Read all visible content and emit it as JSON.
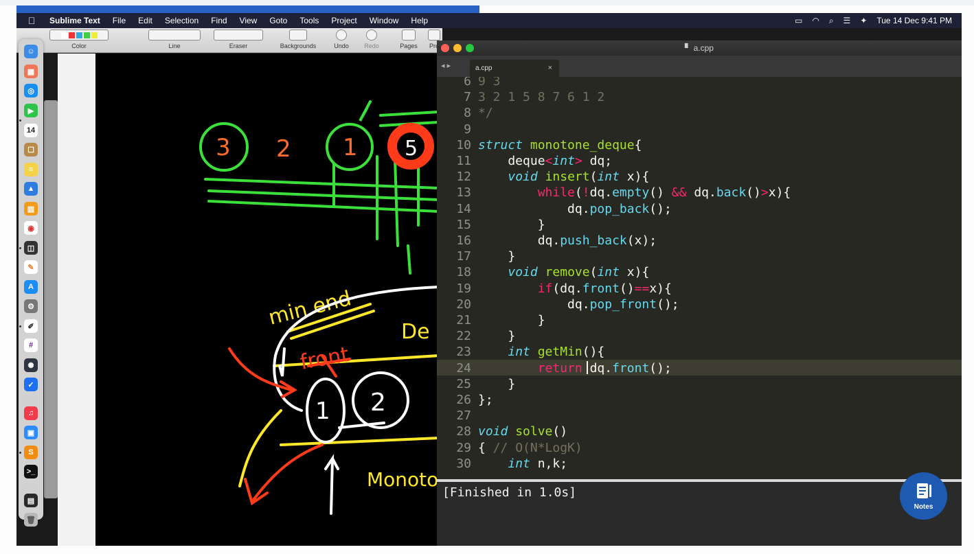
{
  "menubar": {
    "app_name": "Sublime Text",
    "items": [
      "File",
      "Edit",
      "Selection",
      "Find",
      "View",
      "Goto",
      "Tools",
      "Project",
      "Window",
      "Help"
    ],
    "clock": "Tue 14 Dec  9:41 PM"
  },
  "whiteboard_toolbar": {
    "groups": [
      "Color",
      "Line",
      "Eraser",
      "Backgrounds",
      "Undo",
      "Redo",
      "Pages",
      "Pre"
    ]
  },
  "dock": {
    "calendar_day": "14"
  },
  "whiteboard": {
    "labels": [
      "3",
      "2",
      "1",
      "5",
      "min end",
      "front",
      "De",
      "1",
      "2",
      "Monoto"
    ]
  },
  "sublime": {
    "window_title": "a.cpp",
    "tab_label": "a.cpp",
    "tab_close": "×",
    "nav_arrows": "◂ ▸",
    "line_numbers": [
      "6",
      "7",
      "8",
      "9",
      "10",
      "11",
      "12",
      "13",
      "14",
      "15",
      "16",
      "17",
      "18",
      "19",
      "20",
      "21",
      "22",
      "23",
      "24",
      "25",
      "26",
      "27",
      "28",
      "29",
      "30"
    ],
    "code_lines": [
      "9 3",
      "3 2 1 5 8 7 6 1 2",
      "*/",
      "",
      "struct monotone_deque{",
      "    deque<int> dq;",
      "    void insert(int x){",
      "        while(!dq.empty() && dq.back()>x){",
      "            dq.pop_back();",
      "        }",
      "        dq.push_back(x);",
      "    }",
      "    void remove(int x){",
      "        if(dq.front()==x){",
      "            dq.pop_front();",
      "        }",
      "    }",
      "    int getMin(){",
      "        return dq.front();",
      "    }",
      "};",
      "",
      "void solve()",
      "{ // O(N*LogK)",
      "    int n,k;"
    ],
    "console_output": "[Finished in 1.0s]"
  },
  "notes_button": {
    "label": "Notes"
  },
  "colors": {
    "editor_bg": "#272822",
    "keyword": "#66d9ef",
    "control": "#f92672",
    "function": "#a6e22e",
    "comment": "#75715e",
    "menubar_bg": "#1f2236",
    "notes_bg": "#1d5ab0"
  }
}
